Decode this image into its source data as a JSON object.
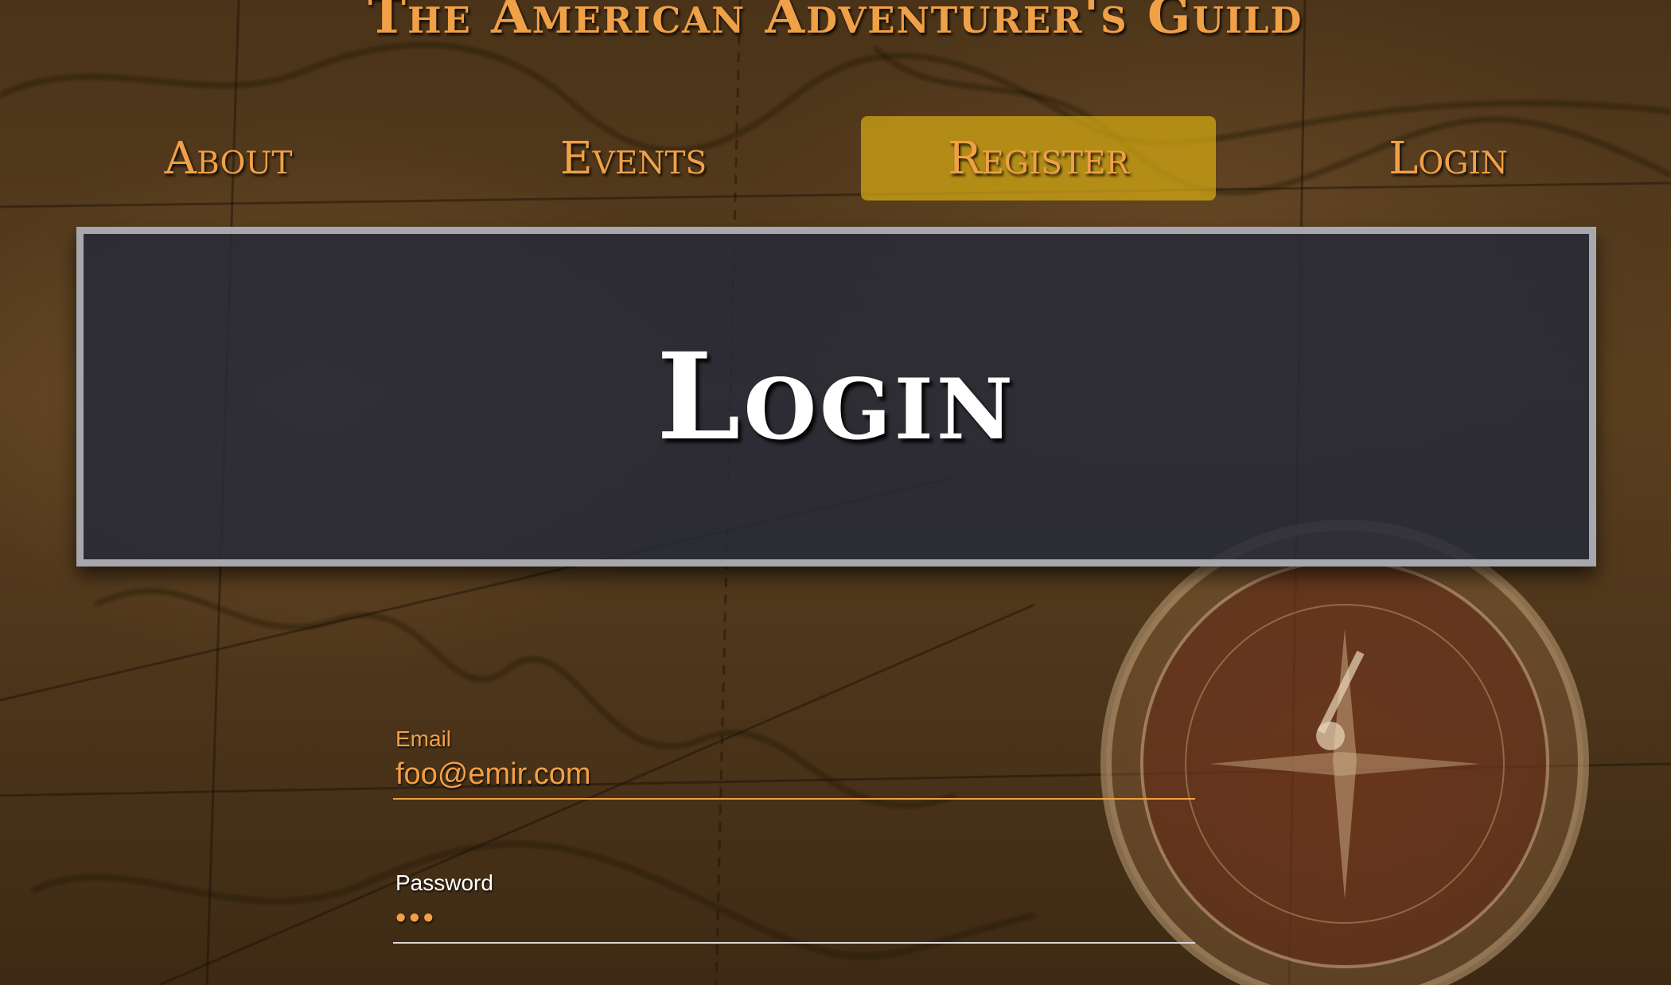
{
  "site": {
    "title": "The American Adventurer's Guild"
  },
  "nav": {
    "items": [
      {
        "label": "About"
      },
      {
        "label": "Events"
      },
      {
        "label": "Register"
      },
      {
        "label": "Login"
      }
    ],
    "active_index": 2
  },
  "hero": {
    "title": "Login"
  },
  "form": {
    "email": {
      "label": "Email",
      "value": "foo@emir.com"
    },
    "password": {
      "label": "Password",
      "value": "•••"
    }
  },
  "colors": {
    "accent": "#f0a047",
    "highlight": "#d6aa14",
    "hero_bg": "#262a38",
    "hero_border": "#a7a8ad"
  }
}
